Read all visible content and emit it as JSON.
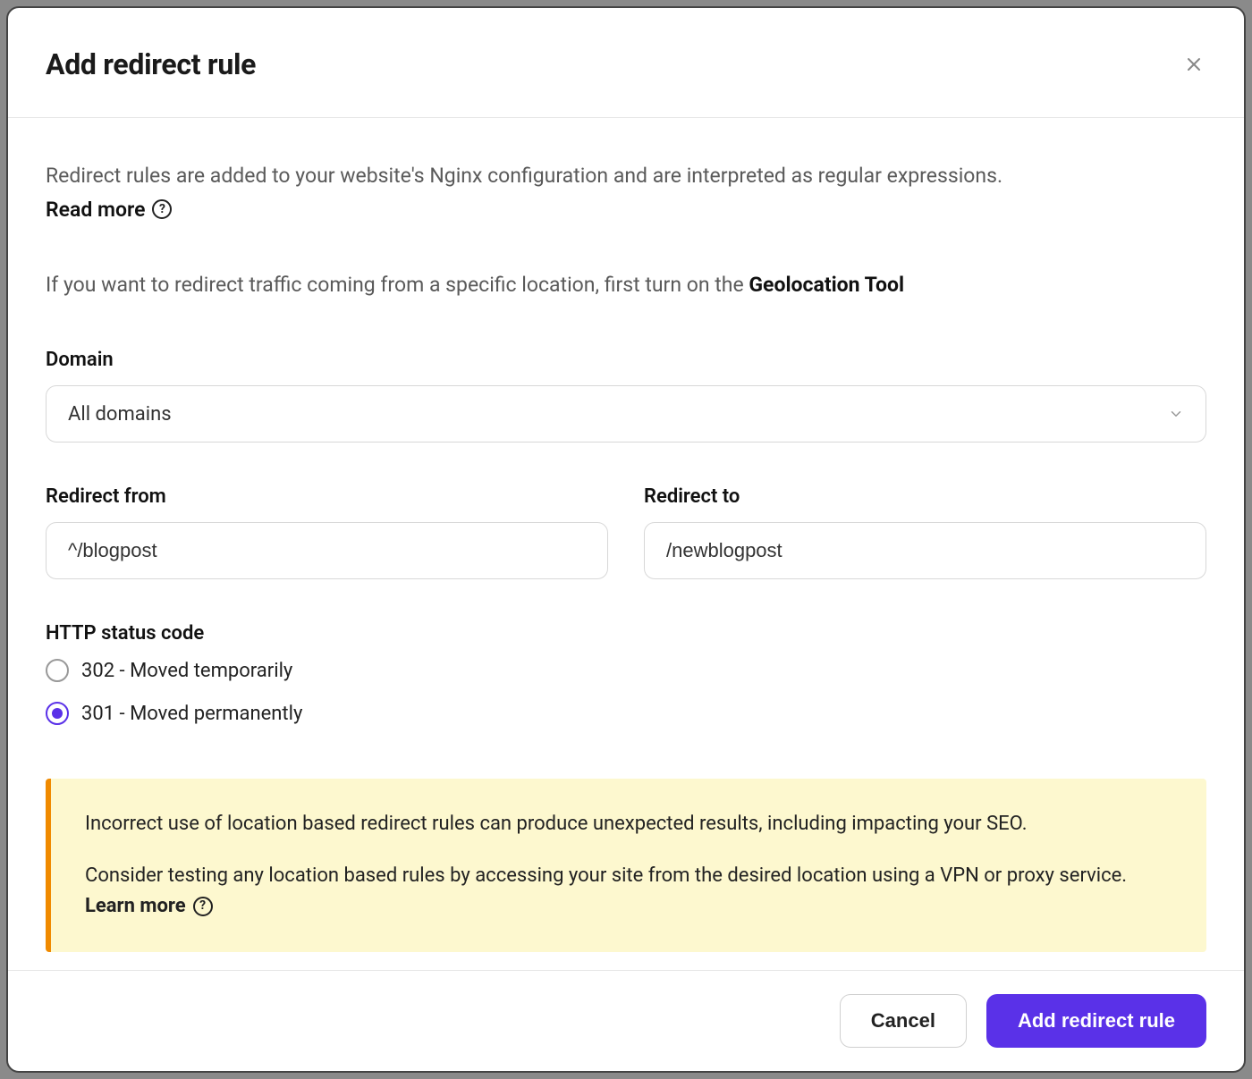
{
  "header": {
    "title": "Add redirect rule"
  },
  "intro": {
    "text": "Redirect rules are added to your website's Nginx configuration and are interpreted as regular expressions.",
    "readmore": "Read more"
  },
  "geo": {
    "prefix": "If you want to redirect traffic coming from a specific location, first turn on the ",
    "link": "Geolocation Tool"
  },
  "domain": {
    "label": "Domain",
    "value": "All domains"
  },
  "redirect_from": {
    "label": "Redirect from",
    "value": "^/blogpost"
  },
  "redirect_to": {
    "label": "Redirect to",
    "value": "/newblogpost"
  },
  "status_code": {
    "label": "HTTP status code",
    "options": [
      {
        "label": "302 - Moved temporarily",
        "selected": false
      },
      {
        "label": "301 - Moved permanently",
        "selected": true
      }
    ]
  },
  "warning": {
    "line1": "Incorrect use of location based redirect rules can produce unexpected results, including impacting your SEO.",
    "line2_prefix": "Consider testing any location based rules by accessing your site from the desired location using a VPN or proxy service. ",
    "learnmore": "Learn more"
  },
  "footer": {
    "cancel": "Cancel",
    "submit": "Add redirect rule"
  }
}
